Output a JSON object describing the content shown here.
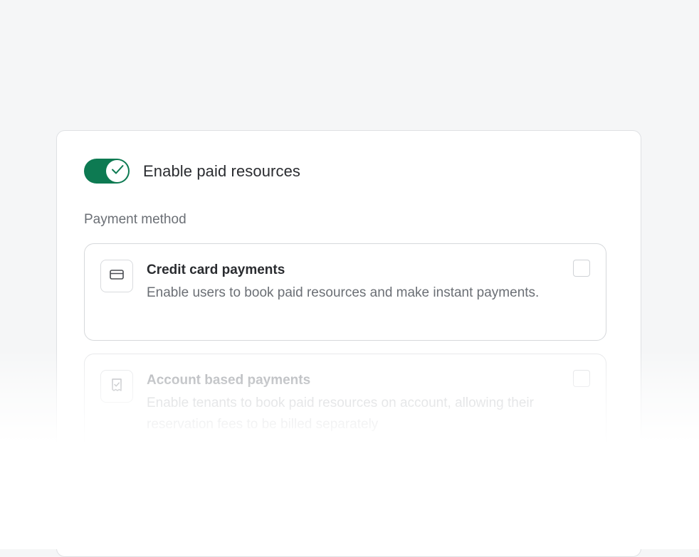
{
  "toggle": {
    "label": "Enable paid resources",
    "checked": true,
    "color": "#0d7a52"
  },
  "payment": {
    "section_label": "Payment method",
    "options": [
      {
        "title": "Credit card payments",
        "description": "Enable users to book paid resources and make instant payments.",
        "icon": "credit-card-icon",
        "checked": false
      },
      {
        "title": "Account based payments",
        "description": "Enable tenants to book paid resources on account, allowing their reservation fees to be billed separately",
        "icon": "receipt-check-icon",
        "checked": false
      }
    ]
  }
}
